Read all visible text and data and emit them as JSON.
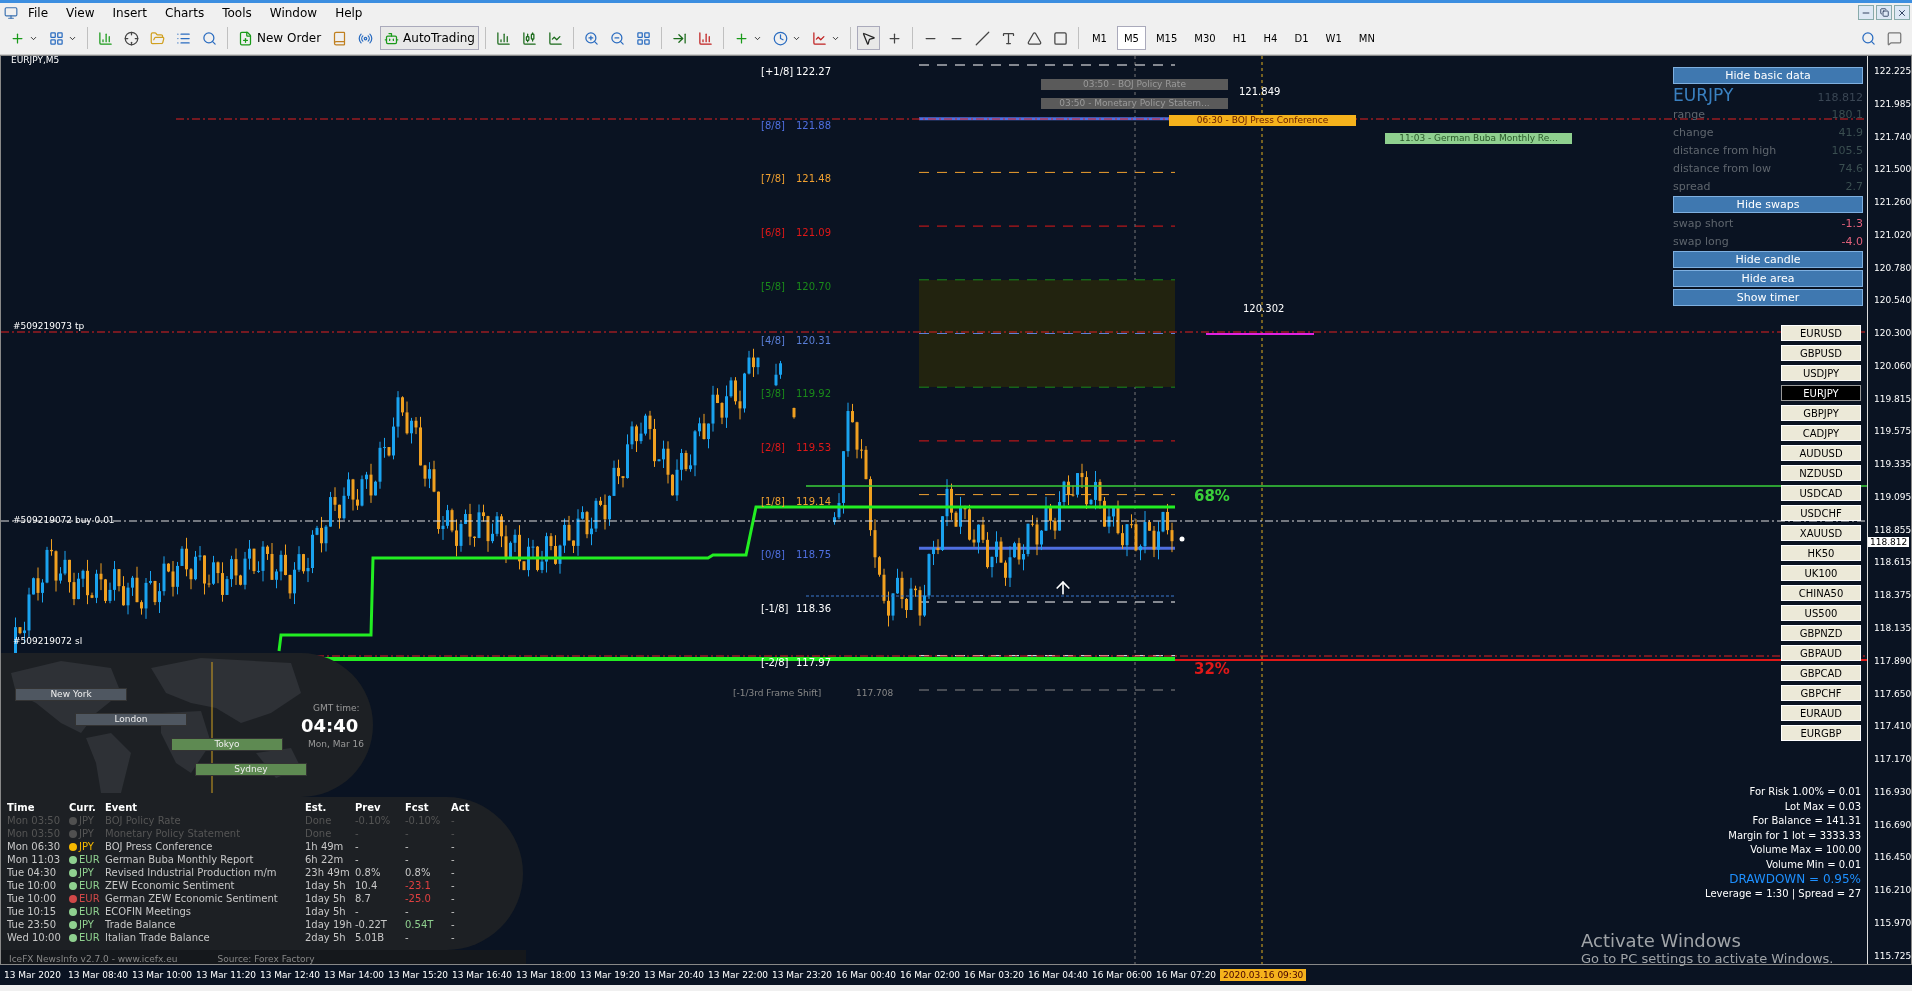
{
  "menu": [
    "File",
    "View",
    "Insert",
    "Charts",
    "Tools",
    "Window",
    "Help"
  ],
  "toolbar": {
    "new_order": "New Order",
    "auto_trading": "AutoTrading",
    "timeframes": [
      {
        "label": "M1",
        "selected": false
      },
      {
        "label": "M5",
        "selected": true
      },
      {
        "label": "M15",
        "selected": false
      },
      {
        "label": "M30",
        "selected": false
      },
      {
        "label": "H1",
        "selected": false
      },
      {
        "label": "H4",
        "selected": false
      },
      {
        "label": "D1",
        "selected": false
      },
      {
        "label": "W1",
        "selected": false
      },
      {
        "label": "MN",
        "selected": false
      }
    ]
  },
  "chart": {
    "symbol": "EURJPY,M5",
    "price_axis": [
      "122.225",
      "121.985",
      "121.740",
      "121.500",
      "121.260",
      "121.020",
      "120.780",
      "120.540",
      "120.300",
      "120.060",
      "119.815",
      "119.575",
      "119.335",
      "119.095",
      "118.855",
      "118.615",
      "118.375",
      "118.135",
      "117.890",
      "117.650",
      "117.410",
      "117.170",
      "116.930",
      "116.690",
      "116.450",
      "116.210",
      "115.970",
      "115.725"
    ],
    "current_price": "118.812",
    "time_axis": [
      "13 Mar 2020",
      "13 Mar 08:40",
      "13 Mar 10:00",
      "13 Mar 11:20",
      "13 Mar 12:40",
      "13 Mar 14:00",
      "13 Mar 15:20",
      "13 Mar 16:40",
      "13 Mar 18:00",
      "13 Mar 19:20",
      "13 Mar 20:40",
      "13 Mar 22:00",
      "13 Mar 23:20",
      "16 Mar 00:40",
      "16 Mar 02:00",
      "16 Mar 03:20",
      "16 Mar 04:40",
      "16 Mar 06:00",
      "16 Mar 07:20"
    ],
    "time_marker": "2020.03.16 09:30",
    "murrey_levels": [
      {
        "tag": "[+1/8]",
        "value": "122.27",
        "color": "#ffffff"
      },
      {
        "tag": "[8/8]",
        "value": "121.88",
        "color": "#4f6fe0"
      },
      {
        "tag": "[7/8]",
        "value": "121.48",
        "color": "#f0a030"
      },
      {
        "tag": "[6/8]",
        "value": "121.09",
        "color": "#e01818"
      },
      {
        "tag": "[5/8]",
        "value": "120.70",
        "color": "#1a8a1a"
      },
      {
        "tag": "[4/8]",
        "value": "120.31",
        "color": "#5a7fd8"
      },
      {
        "tag": "[3/8]",
        "value": "119.92",
        "color": "#1a8a1a"
      },
      {
        "tag": "[2/8]",
        "value": "119.53",
        "color": "#e01818"
      },
      {
        "tag": "[1/8]",
        "value": "119.14",
        "color": "#f0a030"
      },
      {
        "tag": "[0/8]",
        "value": "118.75",
        "color": "#4f6fe0"
      },
      {
        "tag": "[-1/8]",
        "value": "118.36",
        "color": "#ffffff"
      },
      {
        "tag": "[-2/8]",
        "value": "117.97",
        "color": "#ffffff"
      }
    ],
    "frame_shift": {
      "label": "[-1/3rd Frame Shift]",
      "value": "117.708"
    },
    "orders": [
      "#509219073 tp",
      "#509219072 buy 0.01",
      "#509219072 sl"
    ],
    "events": [
      {
        "text": "03:50 - BOJ Policy Rate",
        "color": "#5a5a5a"
      },
      {
        "text": "03:50 - Monetary Policy Statem...",
        "color": "#5a5a5a"
      },
      {
        "text": "06:30 - BOJ Press Conference",
        "color": "#f5b21c"
      },
      {
        "text": "11:03 - German Buba Monthly Re...",
        "color": "#8fd08f"
      }
    ],
    "price_labels": [
      "121.849",
      "120.302"
    ],
    "percent_up": "68%",
    "percent_down": "32%"
  },
  "info_panel": {
    "hide_basic": "Hide basic data",
    "symbol": "EURJPY",
    "price": "118.812",
    "stats": [
      {
        "label": "range",
        "value": "180.1"
      },
      {
        "label": "change",
        "value": "41.9"
      },
      {
        "label": "distance from high",
        "value": "105.5"
      },
      {
        "label": "distance from low",
        "value": "74.6"
      },
      {
        "label": "spread",
        "value": "2.7"
      }
    ],
    "hide_swaps": "Hide swaps",
    "swaps": [
      {
        "label": "swap short",
        "value": "-1.3"
      },
      {
        "label": "swap long",
        "value": "-4.0"
      }
    ],
    "buttons": [
      "Hide candle",
      "Hide area",
      "Show timer"
    ]
  },
  "symbol_buttons": [
    {
      "label": "EURUSD",
      "selected": false
    },
    {
      "label": "GBPUSD",
      "selected": false
    },
    {
      "label": "USDJPY",
      "selected": false
    },
    {
      "label": "EURJPY",
      "selected": true
    },
    {
      "label": "GBPJPY",
      "selected": false
    },
    {
      "label": "CADJPY",
      "selected": false
    },
    {
      "label": "AUDUSD",
      "selected": false
    },
    {
      "label": "NZDUSD",
      "selected": false
    },
    {
      "label": "USDCAD",
      "selected": false
    },
    {
      "label": "USDCHF",
      "selected": false
    },
    {
      "label": "XAUUSD",
      "selected": false
    },
    {
      "label": "HK50",
      "selected": false
    },
    {
      "label": "UK100",
      "selected": false
    },
    {
      "label": "CHINA50",
      "selected": false
    },
    {
      "label": "US500",
      "selected": false
    },
    {
      "label": "GBPNZD",
      "selected": false
    },
    {
      "label": "GBPAUD",
      "selected": false
    },
    {
      "label": "GBPCAD",
      "selected": false
    },
    {
      "label": "GBPCHF",
      "selected": false
    },
    {
      "label": "EURAUD",
      "selected": false
    },
    {
      "label": "EURGBP",
      "selected": false
    }
  ],
  "risk": [
    "For Risk 1.00% = 0.01",
    "Lot Max = 0.03",
    "For Balance = 141.31",
    "Margin for 1 lot = 3333.33",
    "Volume Max = 100.00",
    "Volume Min = 0.01"
  ],
  "drawdown": "DRAWDOWN = 0.95%",
  "leverage": "Leverage = 1:30 | Spread = 27",
  "news": {
    "sessions": [
      {
        "city": "New York",
        "active": false
      },
      {
        "city": "London",
        "active": false
      },
      {
        "city": "Tokyo",
        "active": true
      },
      {
        "city": "Sydney",
        "active": true
      }
    ],
    "gmt_label": "GMT time:",
    "gmt_time": "04:40",
    "gmt_date": "Mon, Mar 16",
    "columns": [
      "Time",
      "Curr.",
      "Event",
      "Est.",
      "Prev",
      "Fcst",
      "Act"
    ],
    "rows": [
      {
        "time": "Mon 03:50",
        "currency": "JPY",
        "event": "BOJ Policy Rate",
        "est": "Done",
        "prev": "-0.10%",
        "fcst": "-0.10%",
        "act": "-",
        "color": "#505050",
        "done": true,
        "fcst_negative": false,
        "fcst_positive": false
      },
      {
        "time": "Mon 03:50",
        "currency": "JPY",
        "event": "Monetary Policy Statement",
        "est": "Done",
        "prev": "-",
        "fcst": "-",
        "act": "-",
        "color": "#505050",
        "done": true,
        "fcst_negative": false,
        "fcst_positive": false
      },
      {
        "time": "Mon 06:30",
        "currency": "JPY",
        "event": "BOJ Press Conference",
        "est": "1h 49m",
        "prev": "-",
        "fcst": "-",
        "act": "-",
        "color": "#f5b800",
        "done": false,
        "fcst_negative": false,
        "fcst_positive": false
      },
      {
        "time": "Mon 11:03",
        "currency": "EUR",
        "event": "German Buba Monthly Report",
        "est": "6h 22m",
        "prev": "-",
        "fcst": "-",
        "act": "-",
        "color": "#8fd08f",
        "done": false,
        "fcst_negative": false,
        "fcst_positive": false
      },
      {
        "time": "Tue 04:30",
        "currency": "JPY",
        "event": "Revised Industrial Production m/m",
        "est": "23h 49m",
        "prev": "0.8%",
        "fcst": "0.8%",
        "act": "-",
        "color": "#8fd08f",
        "done": false,
        "fcst_negative": false,
        "fcst_positive": false
      },
      {
        "time": "Tue 10:00",
        "currency": "EUR",
        "event": "ZEW Economic Sentiment",
        "est": "1day 5h",
        "prev": "10.4",
        "fcst": "-23.1",
        "act": "-",
        "color": "#8fd08f",
        "done": false,
        "fcst_negative": true,
        "fcst_positive": false
      },
      {
        "time": "Tue 10:00",
        "currency": "EUR",
        "event": "German ZEW Economic Sentiment",
        "est": "1day 5h",
        "prev": "8.7",
        "fcst": "-25.0",
        "act": "-",
        "color": "#d04848",
        "done": false,
        "fcst_negative": true,
        "fcst_positive": false
      },
      {
        "time": "Tue 10:15",
        "currency": "EUR",
        "event": "ECOFIN Meetings",
        "est": "1day 5h",
        "prev": "-",
        "fcst": "-",
        "act": "-",
        "color": "#8fd08f",
        "done": false,
        "fcst_negative": false,
        "fcst_positive": false
      },
      {
        "time": "Tue 23:50",
        "currency": "JPY",
        "event": "Trade Balance",
        "est": "1day 19h",
        "prev": "-0.22T",
        "fcst": "0.54T",
        "act": "-",
        "color": "#8fd08f",
        "done": false,
        "fcst_negative": false,
        "fcst_positive": true
      },
      {
        "time": "Wed 10:00",
        "currency": "EUR",
        "event": "Italian Trade Balance",
        "est": "2day 5h",
        "prev": "5.01B",
        "fcst": "-",
        "act": "-",
        "color": "#8fd08f",
        "done": false,
        "fcst_negative": false,
        "fcst_positive": false
      }
    ],
    "footer_left": "IceFX NewsInfo v2.7.0  -  www.icefx.eu",
    "footer_right": "Source: Forex Factory"
  },
  "os_notice": {
    "title": "Activate Windows",
    "text": "Go to PC settings to activate Windows."
  }
}
